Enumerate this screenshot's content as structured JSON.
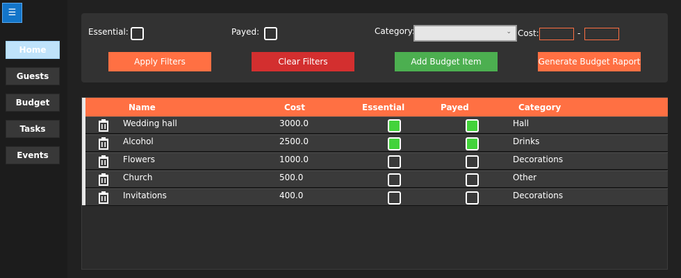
{
  "sidebar": {
    "menu_icon": "hamburger-icon",
    "items": [
      {
        "label": "Home",
        "active": true
      },
      {
        "label": "Guests",
        "active": false
      },
      {
        "label": "Budget",
        "active": false
      },
      {
        "label": "Tasks",
        "active": false
      },
      {
        "label": "Events",
        "active": false
      }
    ]
  },
  "filters": {
    "essential_label": "Essential:",
    "payed_label": "Payed:",
    "category_label": "Category:",
    "category_value": "",
    "cost_label": "Cost:",
    "cost_separator": "-",
    "cost_min": "",
    "cost_max": ""
  },
  "actions": {
    "apply": "Apply Filters",
    "clear": "Clear Filters",
    "add": "Add Budget Item",
    "report": "Generate Budget Raport"
  },
  "colors": {
    "accent": "#ff7043",
    "clear": "#d32f2f",
    "add": "#4caf50",
    "check_on": "#43d33b",
    "nav_active": "#bfe3fb"
  },
  "table": {
    "columns": [
      "Name",
      "Cost",
      "Essential",
      "Payed",
      "Category"
    ],
    "rows": [
      {
        "name": "Wedding hall",
        "cost": "3000.0",
        "essential": true,
        "payed": true,
        "category": "Hall"
      },
      {
        "name": "Alcohol",
        "cost": "2500.0",
        "essential": true,
        "payed": true,
        "category": "Drinks"
      },
      {
        "name": "Flowers",
        "cost": "1000.0",
        "essential": false,
        "payed": false,
        "category": "Decorations"
      },
      {
        "name": "Church",
        "cost": "500.0",
        "essential": false,
        "payed": false,
        "category": "Other"
      },
      {
        "name": "Invitations",
        "cost": "400.0",
        "essential": false,
        "payed": false,
        "category": "Decorations"
      }
    ]
  }
}
